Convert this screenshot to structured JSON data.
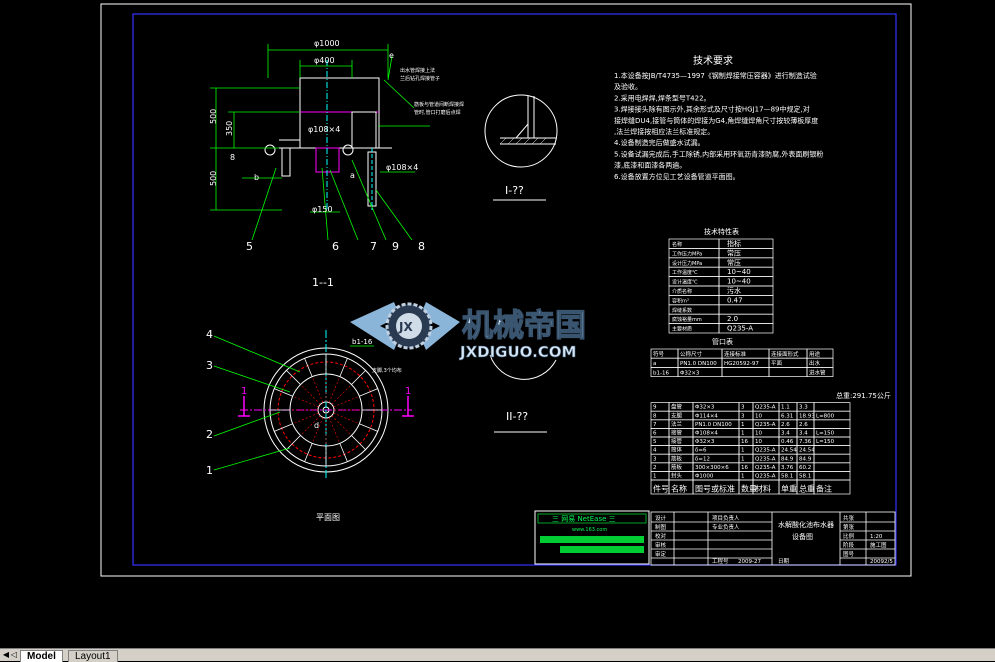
{
  "drawing": {
    "section_view_title": "1--1",
    "detail1_title": "I-??",
    "detail2_title": "II-??",
    "plan_view_title": "平面图",
    "dims": {
      "phi1000": "φ1000",
      "phi400": "φ400",
      "phi108x4": "φ108×4",
      "phi108x4b": "φ108×4",
      "phi150": "φ150",
      "d500a": "500",
      "d350": "350",
      "d500b": "500",
      "d8": "8",
      "b_label": "b",
      "a_label": "a",
      "d_label": "d",
      "b1_label": "b1-16",
      "e_label": "e"
    },
    "callouts": [
      "5",
      "6",
      "7",
      "9",
      "8",
      "4",
      "3",
      "2",
      "1"
    ],
    "tech_req": {
      "title": "技术要求",
      "lines": [
        "1.本设备按JB/T4735—1997《钢制焊接常压容器》进行制造试验",
        "及验收。",
        "2.采用电焊焊,焊条型号T422。",
        "3.焊接接头除有图示外,其余形式及尺寸按HGJ17—89中规定,对",
        "接焊缝DU4,接管与筒体的焊接为G4,角焊缝焊角尺寸按较薄板厚度",
        ",法兰焊接按相应法兰标准规定。",
        "4.设备制造完后做盛水试漏。",
        "5.设备试漏完成后,手工除锈,内部采用环氧沥青漆防腐,外表面刷银粉",
        "漆,底漆和面漆各两遍。",
        "6.设备放置方位见工艺设备管道平面图。"
      ]
    },
    "tech_table": {
      "title": "技术特性表",
      "rows": [
        [
          "工作压力MPa",
          "常压"
        ],
        [
          "设计压力MPa",
          "常压"
        ],
        [
          "工作温度℃",
          "10~40"
        ],
        [
          "设计温度℃",
          "10~40"
        ],
        [
          "介质名称",
          "污水"
        ],
        [
          "容积m³",
          "0.47"
        ],
        [
          "焊缝系数",
          ""
        ],
        [
          "腐蚀裕量mm",
          "2.0"
        ],
        [
          "主要材质",
          "Q235-A"
        ]
      ],
      "headers": [
        "名称",
        "指标"
      ]
    },
    "nozzle_table": {
      "title": "管口表",
      "headers": [
        "符号",
        "公称尺寸",
        "连接标准",
        "连接面形式",
        "用途"
      ],
      "rows": [
        [
          "a",
          "PN1.0 DN100",
          "HG20592-97",
          "平面",
          "出水"
        ],
        [
          "b1-16",
          "Φ32×3",
          "",
          "",
          "进水管"
        ]
      ]
    },
    "total_weight": "总重:291.75公斤",
    "bom": {
      "headers": [
        "件号",
        "名称",
        "图号或标准",
        "数量",
        "材料",
        "单重",
        "总重",
        "备注"
      ],
      "rows": [
        [
          "9",
          "盘管",
          "Φ32×3",
          "3",
          "Q235-A",
          "1.1",
          "3.3",
          ""
        ],
        [
          "8",
          "支腿",
          "Φ114×4",
          "3",
          "10",
          "6.31",
          "18.93",
          "L=800"
        ],
        [
          "7",
          "法兰",
          "PN1.0 DN100",
          "1",
          "Q235-A",
          "2.6",
          "2.6",
          ""
        ],
        [
          "6",
          "接管",
          "Φ108×4",
          "1",
          "10",
          "3.4",
          "3.4",
          "L=150"
        ],
        [
          "5",
          "接管",
          "Φ32×3",
          "16",
          "10",
          "0.46",
          "7.36",
          "L=150"
        ],
        [
          "4",
          "筒体",
          "δ=6",
          "1",
          "Q235-A",
          "24.54",
          "24.54",
          ""
        ],
        [
          "3",
          "筋板",
          "δ=12",
          "1",
          "Q235-A",
          "84.9",
          "84.9",
          ""
        ],
        [
          "2",
          "筋板",
          "300×300×6",
          "16",
          "Q235-A",
          "3.76",
          "60.2",
          ""
        ],
        [
          "1",
          "封头",
          "Φ1000",
          "1",
          "Q235-A",
          "58.1",
          "58.1",
          ""
        ]
      ]
    },
    "title_block": {
      "drawing_name_1": "水解酸化池布水器",
      "drawing_name_2": "设备图",
      "left_labels": [
        "设计",
        "制图",
        "校对",
        "审核",
        "审定"
      ],
      "mid_labels": [
        "项目负责人",
        "专业负责人"
      ],
      "scale_label": "比例",
      "scale_value": "1:20",
      "stage_label": "阶段",
      "stage_value": "施工图",
      "sheet_label": "图号",
      "date_label": "日期",
      "right_vals": [
        "共张",
        "第张",
        "1:20",
        "施工图",
        "20092/5"
      ],
      "project_label": "工程号",
      "project_value": "2009-27"
    },
    "stamp": {
      "title": "三 网易 NetEase 三",
      "url": "www.163.com",
      "bar_color": "#00cc33"
    },
    "watermark": {
      "cn": "机械帝国",
      "en": "JXDIGUO.COM",
      "badge": "JX"
    },
    "colors": {
      "line_white": "#ffffff",
      "line_green": "#00ff00",
      "line_cyan": "#00ffff",
      "line_magenta": "#ff00ff",
      "frame_blue": "#3333ff"
    }
  },
  "layout_tabs": [
    {
      "label": "Model",
      "active": true
    },
    {
      "label": "Layout1",
      "active": false
    }
  ]
}
